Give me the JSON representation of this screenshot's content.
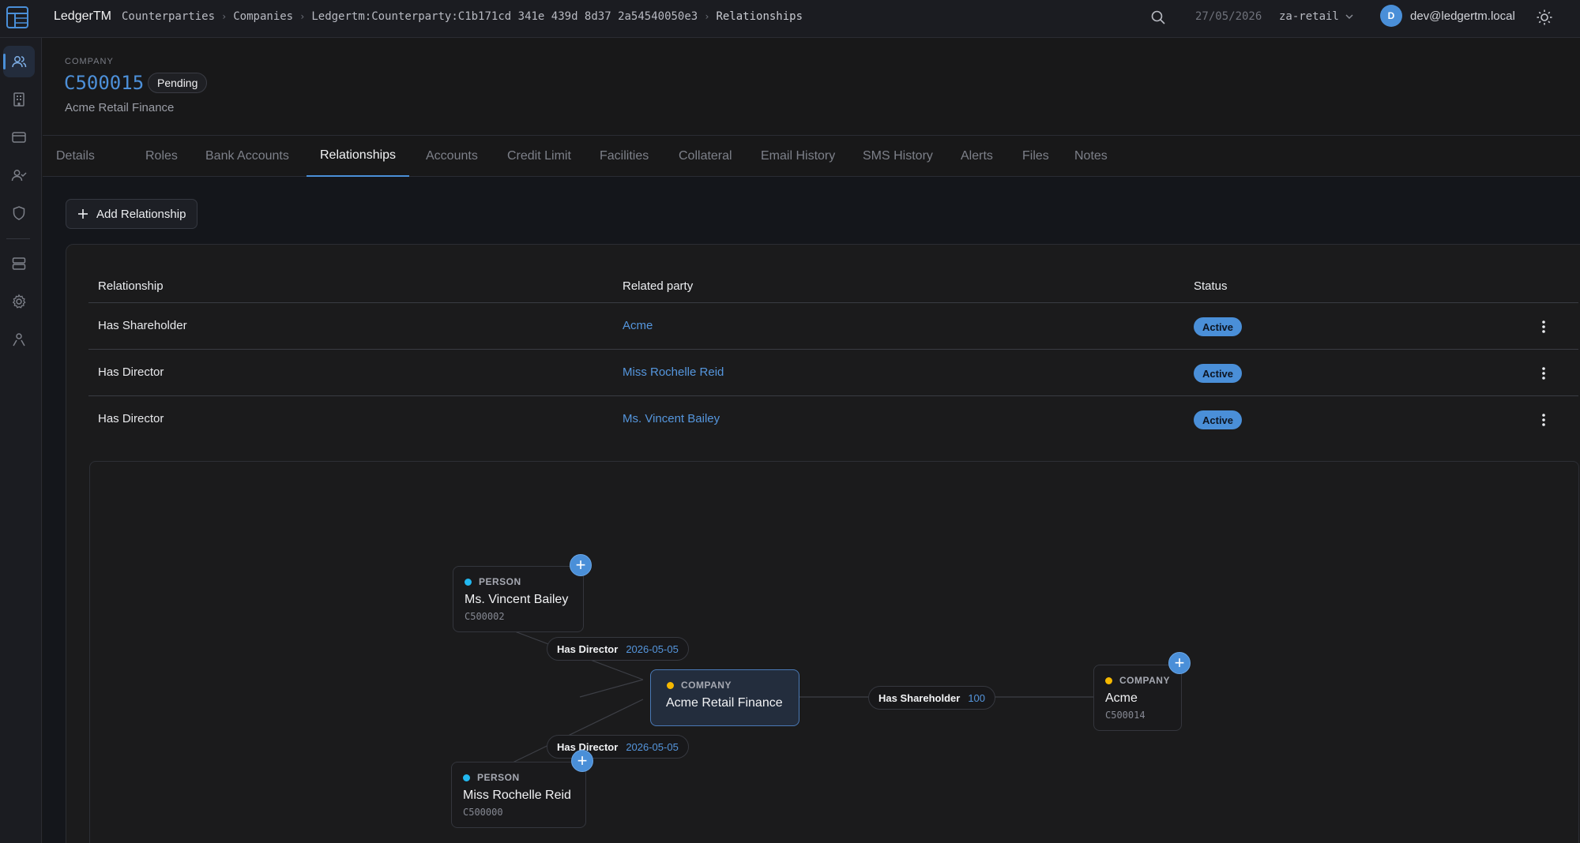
{
  "app": {
    "brand": "LedgerTM",
    "breadcrumbs": [
      "Counterparties",
      "Companies",
      "Ledgertm:Counterparty:C1b171cd 341e 439d 8d37 2a54540050e3",
      "Relationships"
    ],
    "date": "27/05/2026",
    "tenant": "za-retail",
    "user_initial": "D",
    "user_email": "dev@ledgertm.local"
  },
  "header": {
    "kicker": "COMPANY",
    "code": "C500015",
    "status": "Pending",
    "name": "Acme Retail Finance"
  },
  "tabs": [
    "Details",
    "Roles",
    "Bank Accounts",
    "Relationships",
    "Accounts",
    "Credit Limit",
    "Facilities",
    "Collateral",
    "Email History",
    "SMS History",
    "Alerts",
    "Files",
    "Notes"
  ],
  "active_tab": "Relationships",
  "actions": {
    "add_relationship": "Add Relationship"
  },
  "table": {
    "columns": [
      "Relationship",
      "Related party",
      "Status"
    ],
    "rows": [
      {
        "relationship": "Has Shareholder",
        "party": "Acme",
        "status": "Active"
      },
      {
        "relationship": "Has Director",
        "party": "Miss Rochelle Reid",
        "status": "Active"
      },
      {
        "relationship": "Has Director",
        "party": "Ms. Vincent Bailey",
        "status": "Active"
      }
    ]
  },
  "graph": {
    "nodes": {
      "bailey": {
        "type": "PERSON",
        "name": "Ms. Vincent Bailey",
        "code": "C500002"
      },
      "center": {
        "type": "COMPANY",
        "name": "Acme Retail Finance"
      },
      "acme": {
        "type": "COMPANY",
        "name": "Acme",
        "code": "C500014"
      },
      "reid": {
        "type": "PERSON",
        "name": "Miss Rochelle Reid",
        "code": "C500000"
      }
    },
    "edges": {
      "director_top": {
        "label": "Has Director",
        "value": "2026-05-05"
      },
      "director_bottom": {
        "label": "Has Director",
        "value": "2026-05-05"
      },
      "shareholder": {
        "label": "Has Shareholder",
        "value": "100"
      }
    }
  },
  "colors": {
    "accent": "#4a8fd8",
    "person_dot": "#22b8f0",
    "company_dot": "#f5b800"
  },
  "icons": {
    "plus": "+"
  }
}
